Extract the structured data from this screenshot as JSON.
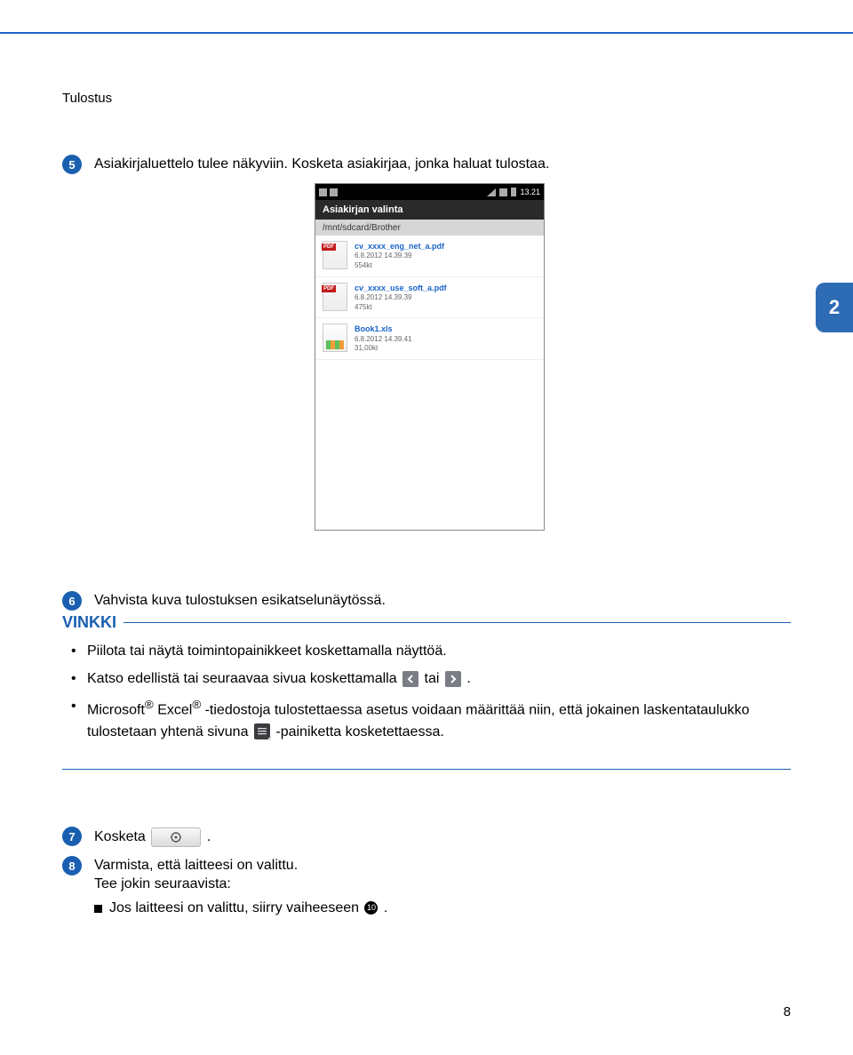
{
  "section_title": "Tulostus",
  "page_tab": "2",
  "steps": {
    "s5": {
      "num": "5",
      "text": "Asiakirjaluettelo tulee näkyviin. Kosketa asiakirjaa, jonka haluat tulostaa."
    },
    "s6": {
      "num": "6",
      "text": "Vahvista kuva tulostuksen esikatselunäytössä."
    },
    "s7": {
      "num": "7",
      "text_a": "Kosketa ",
      "text_b": "."
    },
    "s8": {
      "num": "8",
      "line1": "Varmista, että laitteesi on valittu.",
      "line2": "Tee jokin seuraavista:",
      "sub1_a": "Jos laitteesi on valittu, siirry vaiheeseen ",
      "sub1_ref": "10",
      "sub1_b": "."
    }
  },
  "vinkki": {
    "label": "VINKKI",
    "b1": "Piilota tai näytä toimintopainikkeet koskettamalla näyttöä.",
    "b2_a": "Katso edellistä tai seuraavaa sivua koskettamalla ",
    "b2_mid": " tai ",
    "b2_b": ".",
    "b3_a": "Microsoft",
    "b3_b": " Excel",
    "b3_c": " -tiedostoja tulostettaessa asetus voidaan määrittää niin, että jokainen laskentataulukko tulostetaan yhtenä sivuna ",
    "b3_d": "-painiketta kosketettaessa."
  },
  "screenshot": {
    "status_time": "13.21",
    "title": "Asiakirjan valinta",
    "path": "/mnt/sdcard/Brother",
    "files": [
      {
        "name": "cv_xxxx_eng_net_a.pdf",
        "date": "6.8.2012 14.39.39",
        "size": "554kt",
        "type": "pdf"
      },
      {
        "name": "cv_xxxx_use_soft_a.pdf",
        "date": "6.8.2012 14.39.39",
        "size": "475kt",
        "type": "pdf"
      },
      {
        "name": "Book1.xls",
        "date": "6.8.2012 14.39.41",
        "size": "31,00kt",
        "type": "xls"
      }
    ]
  },
  "page_number": "8"
}
